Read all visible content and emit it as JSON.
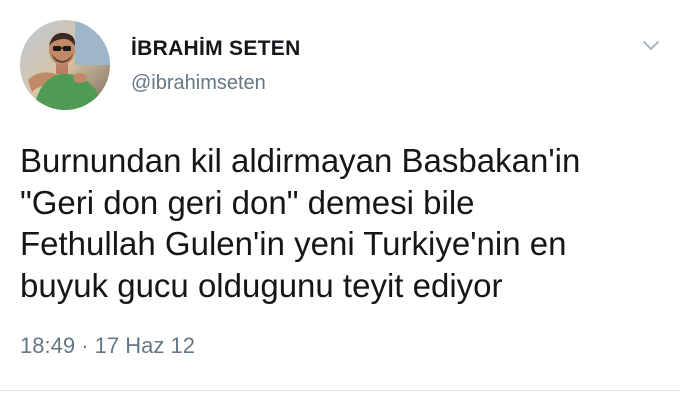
{
  "tweet": {
    "author": {
      "display_name": "İBRAHİM SETEN",
      "handle": "@ibrahimseten"
    },
    "text_lines": [
      "Burnundan kil aldirmayan Basbakan'in",
      "\"Geri don geri don\" demesi bile",
      "Fethullah Gulen'in yeni Turkiye'nin en",
      "buyuk gucu oldugunu teyit ediyor"
    ],
    "time": "18:49",
    "separator": "·",
    "date": "17 Haz 12"
  },
  "icons": {
    "menu": "chevron-down-icon"
  },
  "colors": {
    "text_primary": "#14171a",
    "text_secondary": "#657786",
    "chevron": "#aab8c2",
    "divider": "#e1e8ed"
  }
}
